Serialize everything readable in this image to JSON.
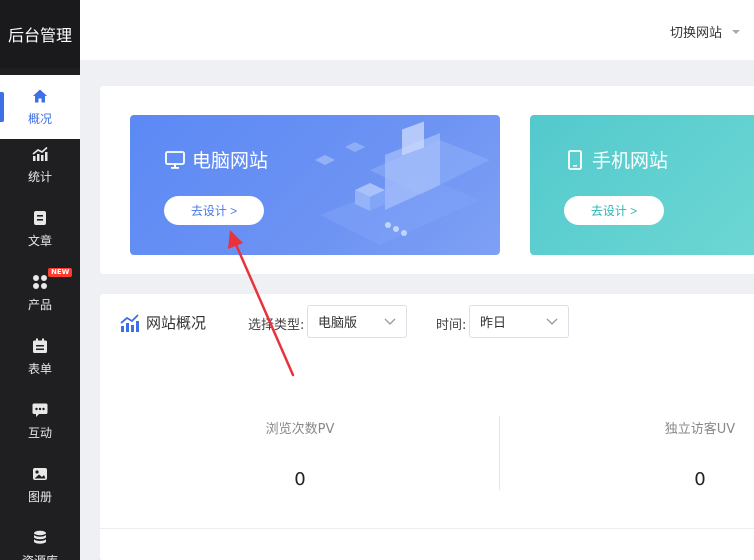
{
  "app": {
    "title": "后台管理"
  },
  "header": {
    "switch_site": "切换网站"
  },
  "sidebar": {
    "items": [
      {
        "label": "概况",
        "icon": "home-icon",
        "active": true
      },
      {
        "label": "统计",
        "icon": "trend-chart-icon"
      },
      {
        "label": "文章",
        "icon": "document-icon"
      },
      {
        "label": "产品",
        "icon": "grid-icon",
        "badge": "NEW"
      },
      {
        "label": "表单",
        "icon": "form-icon"
      },
      {
        "label": "互动",
        "icon": "chat-icon"
      },
      {
        "label": "图册",
        "icon": "album-icon"
      },
      {
        "label": "资源库",
        "icon": "database-icon"
      }
    ]
  },
  "cards": {
    "pc": {
      "title": "电脑网站",
      "button": "去设计 >",
      "icon": "monitor-icon"
    },
    "mobile": {
      "title": "手机网站",
      "button": "去设计 >",
      "icon": "phone-icon"
    }
  },
  "overview": {
    "title": "网站概况",
    "type_label": "选择类型:",
    "type_value": "电脑版",
    "time_label": "时间:",
    "time_value": "昨日",
    "stats": [
      {
        "label": "浏览次数PV",
        "value": "0"
      },
      {
        "label": "独立访客UV",
        "value": "0"
      }
    ]
  },
  "colors": {
    "sidebar_bg": "#1f1f22",
    "accent": "#3f6fe6",
    "pc_card": "#5b89f5",
    "mobile_card": "#53c9cd",
    "arrow": "#e8323c"
  }
}
